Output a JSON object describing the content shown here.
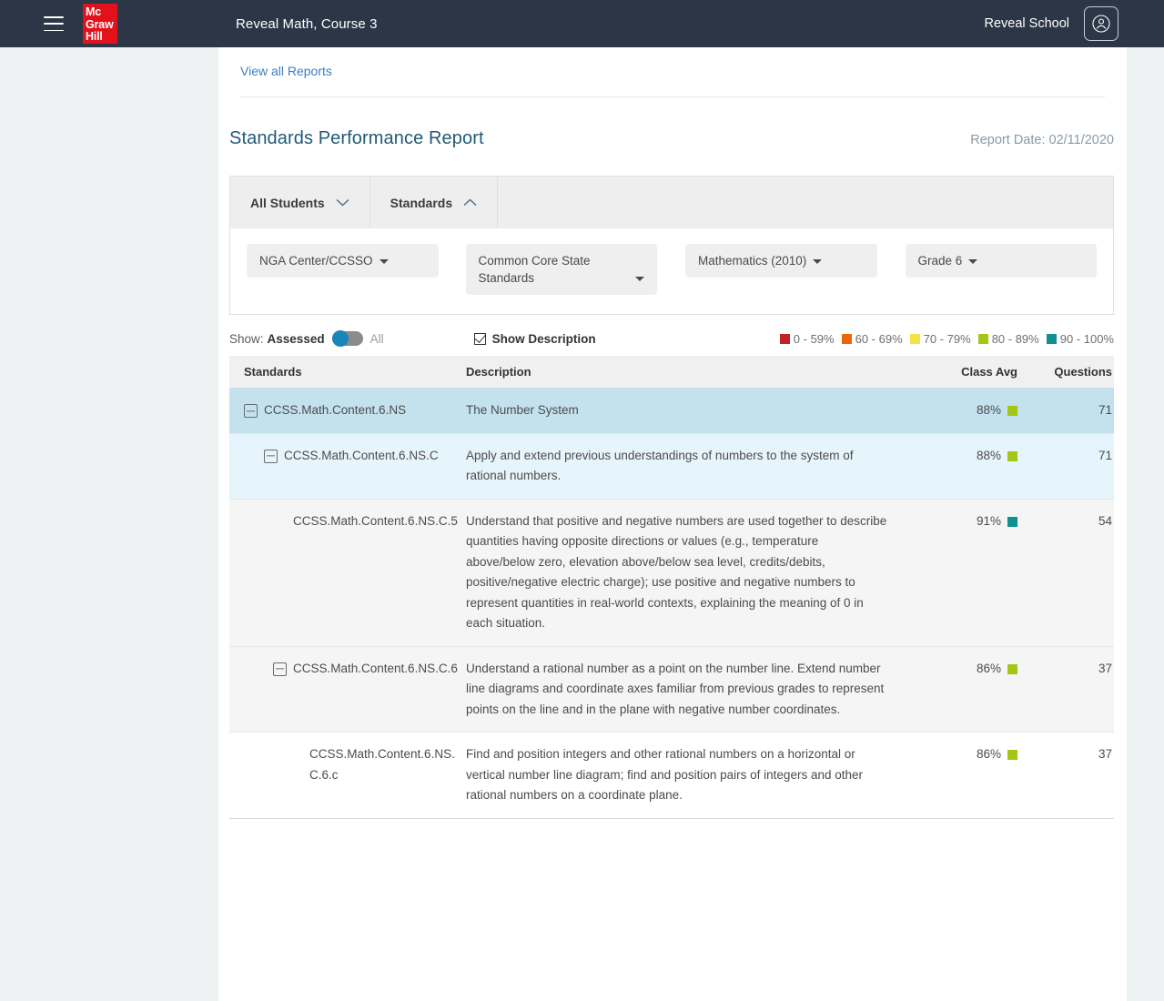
{
  "topbar": {
    "menu_icon": "hamburger-icon",
    "logo_lines": [
      "Mc",
      "Graw",
      "Hill"
    ],
    "title": "Reveal Math, Course 3",
    "school": "Reveal School",
    "avatar_icon": "user-circle-icon"
  },
  "breadcrumb": {
    "view_all_reports": "View all Reports"
  },
  "header": {
    "page_title": "Standards Performance Report",
    "report_date": "Report Date: 02/11/2020"
  },
  "tabs": [
    {
      "label": "All Students",
      "icon": "chevron-down-icon",
      "expanded": false
    },
    {
      "label": "Standards",
      "icon": "chevron-up-icon",
      "expanded": true
    }
  ],
  "filters": [
    {
      "name": "organization",
      "value": "NGA Center/CCSSO"
    },
    {
      "name": "standard-set",
      "value": "Common Core State Standards"
    },
    {
      "name": "subject",
      "value": "Mathematics (2010)"
    },
    {
      "name": "grade",
      "value": "Grade 6"
    }
  ],
  "controls": {
    "show_label": "Show:",
    "assessed_label": "Assessed",
    "all_label": "All",
    "toggle_state": "Assessed",
    "show_description_label": "Show Description",
    "show_description_checked": true
  },
  "legend": [
    {
      "label": "0 - 59%",
      "color": "#c22226"
    },
    {
      "label": "60 - 69%",
      "color": "#ec6608"
    },
    {
      "label": "70 - 79%",
      "color": "#f2e340"
    },
    {
      "label": "80 - 89%",
      "color": "#a3c617"
    },
    {
      "label": "90 - 100%",
      "color": "#0f9190"
    }
  ],
  "table": {
    "columns": [
      "Standards",
      "Description",
      "Class Avg",
      "Questions"
    ],
    "rows": [
      {
        "level": 0,
        "expandable": true,
        "standard": "CCSS.Math.Content.6.NS",
        "description": "The Number System",
        "class_avg": "88%",
        "avg_color": "#a3c617",
        "questions": "71"
      },
      {
        "level": 1,
        "expandable": true,
        "standard": "CCSS.Math.Content.6.NS.C",
        "description": "Apply and extend previous understandings of numbers to the system of rational numbers.",
        "class_avg": "88%",
        "avg_color": "#a3c617",
        "questions": "71"
      },
      {
        "level": 2,
        "expandable": false,
        "standard": "CCSS.Math.Content.6.NS.C.5",
        "description": "Understand that positive and negative numbers are used together to describe quantities having opposite directions or values (e.g., temperature above/below zero, elevation above/below sea level, credits/debits, positive/negative electric charge); use positive and negative numbers to represent quantities in real-world contexts, explaining the meaning of 0 in each situation.",
        "class_avg": "91%",
        "avg_color": "#0f9190",
        "questions": "54"
      },
      {
        "level": 2,
        "expandable": true,
        "standard": "CCSS.Math.Content.6.NS.C.6",
        "description": "Understand a rational number as a point on the number line. Extend number line diagrams and coordinate axes familiar from previous grades to represent points on the line and in the plane with negative number coordinates.",
        "class_avg": "86%",
        "avg_color": "#a3c617",
        "questions": "37"
      },
      {
        "level": 3,
        "expandable": false,
        "standard": "CCSS.Math.Content.6.NS.C.6.c",
        "description": "Find and position integers and other rational numbers on a horizontal or vertical number line diagram; find and position pairs of integers and other rational numbers on a coordinate plane.",
        "class_avg": "86%",
        "avg_color": "#a3c617",
        "questions": "37"
      }
    ]
  }
}
